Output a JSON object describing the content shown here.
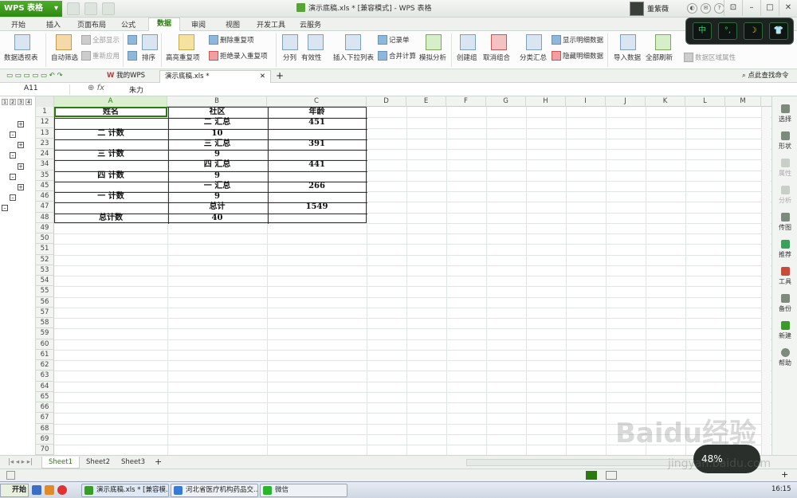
{
  "app": {
    "logo": "WPS 表格",
    "window_title": "演示底稿.xls * [兼容模式] - WPS 表格",
    "user": "董紫薇"
  },
  "colors": {
    "accent": "#2a7a10",
    "brand": "#3b9a1e"
  },
  "menu": {
    "tabs": [
      "开始",
      "插入",
      "页面布局",
      "公式",
      "数据",
      "审阅",
      "视图",
      "开发工具",
      "云服务"
    ],
    "active": "数据"
  },
  "ribbon": {
    "pivot": "数据透视表",
    "autofilter": "自动筛选",
    "show_all": "全部显示",
    "reapply": "重新应用",
    "sort": "排序",
    "highlight_dup": "高亮重复项",
    "delete_dup": "删除重复项",
    "reject_dup": "拒绝录入重复项",
    "split": "分列",
    "validity": "有效性",
    "insert_dropdown": "插入下拉列表",
    "record": "记录单",
    "merge_calc": "合并计算",
    "simulate": "模拟分析",
    "create_group": "创建组",
    "cancel_group": "取消组合",
    "subtotal": "分类汇总",
    "show_detail": "显示明细数据",
    "hide_detail": "隐藏明细数据",
    "import": "导入数据",
    "refresh_all": "全部刷新",
    "area_props": "数据区域属性"
  },
  "floater": {
    "buttons": [
      "中",
      "°,",
      "☽",
      "👕"
    ]
  },
  "doctabs": {
    "mywps": "我的WPS",
    "file": "演示底稿.xls *",
    "search": "点此查找命令"
  },
  "formula_bar": {
    "name_box": "A11",
    "formula": "朱力"
  },
  "outline": {
    "levels": [
      "1",
      "2",
      "3",
      "4"
    ]
  },
  "columns": [
    "A",
    "B",
    "C",
    "D",
    "E",
    "F",
    "G",
    "H",
    "I",
    "J",
    "K",
    "L",
    "M"
  ],
  "rows": [
    "1",
    "12",
    "13",
    "23",
    "24",
    "34",
    "35",
    "45",
    "46",
    "47",
    "48",
    "49",
    "50",
    "51",
    "52",
    "53",
    "54",
    "55",
    "56",
    "57",
    "58",
    "59",
    "60",
    "61",
    "62",
    "63",
    "64",
    "65",
    "66",
    "67",
    "68",
    "69",
    "70"
  ],
  "table": {
    "headers": [
      "姓名",
      "社区",
      "年龄"
    ],
    "rows": [
      [
        "",
        "二 汇总",
        "451"
      ],
      [
        "二 计数",
        "10",
        ""
      ],
      [
        "",
        "三 汇总",
        "391"
      ],
      [
        "三 计数",
        "9",
        ""
      ],
      [
        "",
        "四 汇总",
        "441"
      ],
      [
        "四 计数",
        "9",
        ""
      ],
      [
        "",
        "一 汇总",
        "266"
      ],
      [
        "一 计数",
        "9",
        ""
      ],
      [
        "",
        "总计",
        "1549"
      ],
      [
        "总计数",
        "40",
        ""
      ]
    ]
  },
  "right_panel": [
    "选择",
    "形状",
    "属性",
    "分析",
    "传图",
    "推荐",
    "工具",
    "备份",
    "新建",
    "帮助"
  ],
  "sheets": {
    "tabs": [
      "Sheet1",
      "Sheet2",
      "Sheet3"
    ],
    "active": "Sheet1"
  },
  "taskbar": {
    "start": "开始",
    "items": [
      "演示底稿.xls * [兼容模...",
      "河北省医疗机构药品交...",
      "微信"
    ],
    "clock": "16:15"
  },
  "watermark": {
    "main": "Baidu经验",
    "sub": "jingyan.baidu.com",
    "badge": "48%"
  }
}
